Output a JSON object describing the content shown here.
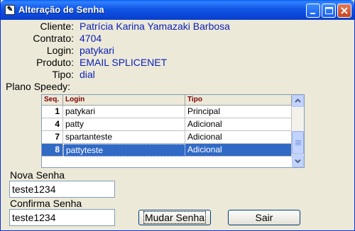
{
  "window": {
    "title": "Alteração de Senha",
    "app_icon": "pencil-icon",
    "controls": [
      "minimize-icon",
      "maximize-icon",
      "close-icon"
    ]
  },
  "form": {
    "cliente_label": "Cliente:",
    "cliente_value": "Patrícia Karina Yamazaki Barbosa",
    "contrato_label": "Contrato:",
    "contrato_value": "4704",
    "login_label": "Login:",
    "login_value": "patykari",
    "produto_label": "Produto:",
    "produto_value": "EMAIL SPLICENET",
    "tipo_label": "Tipo:",
    "tipo_value": "dial",
    "plano_label": "Plano Speedy:"
  },
  "grid": {
    "headers": [
      "Seq.",
      "Login",
      "Tipo"
    ],
    "rows": [
      {
        "seq": "1",
        "login": "patykari",
        "tipo": "Principal"
      },
      {
        "seq": "4",
        "login": "patty",
        "tipo": "Adicional"
      },
      {
        "seq": "7",
        "login": "spartanteste",
        "tipo": "Adicional"
      },
      {
        "seq": "8",
        "login": "pattyteste",
        "tipo": "Adicional"
      }
    ],
    "selected_row": 3
  },
  "password": {
    "nova_label": "Nova Senha",
    "nova_value": "teste1234",
    "confirma_label": "Confirma Senha",
    "confirma_value": "teste1234"
  },
  "buttons": {
    "mudar": "Mudar Senha",
    "sair": "Sair"
  },
  "colors": {
    "value_text": "#0a1fb8",
    "selection": "#316ac5",
    "window_bg": "#ece9d8",
    "header_text": "#7b0000"
  }
}
